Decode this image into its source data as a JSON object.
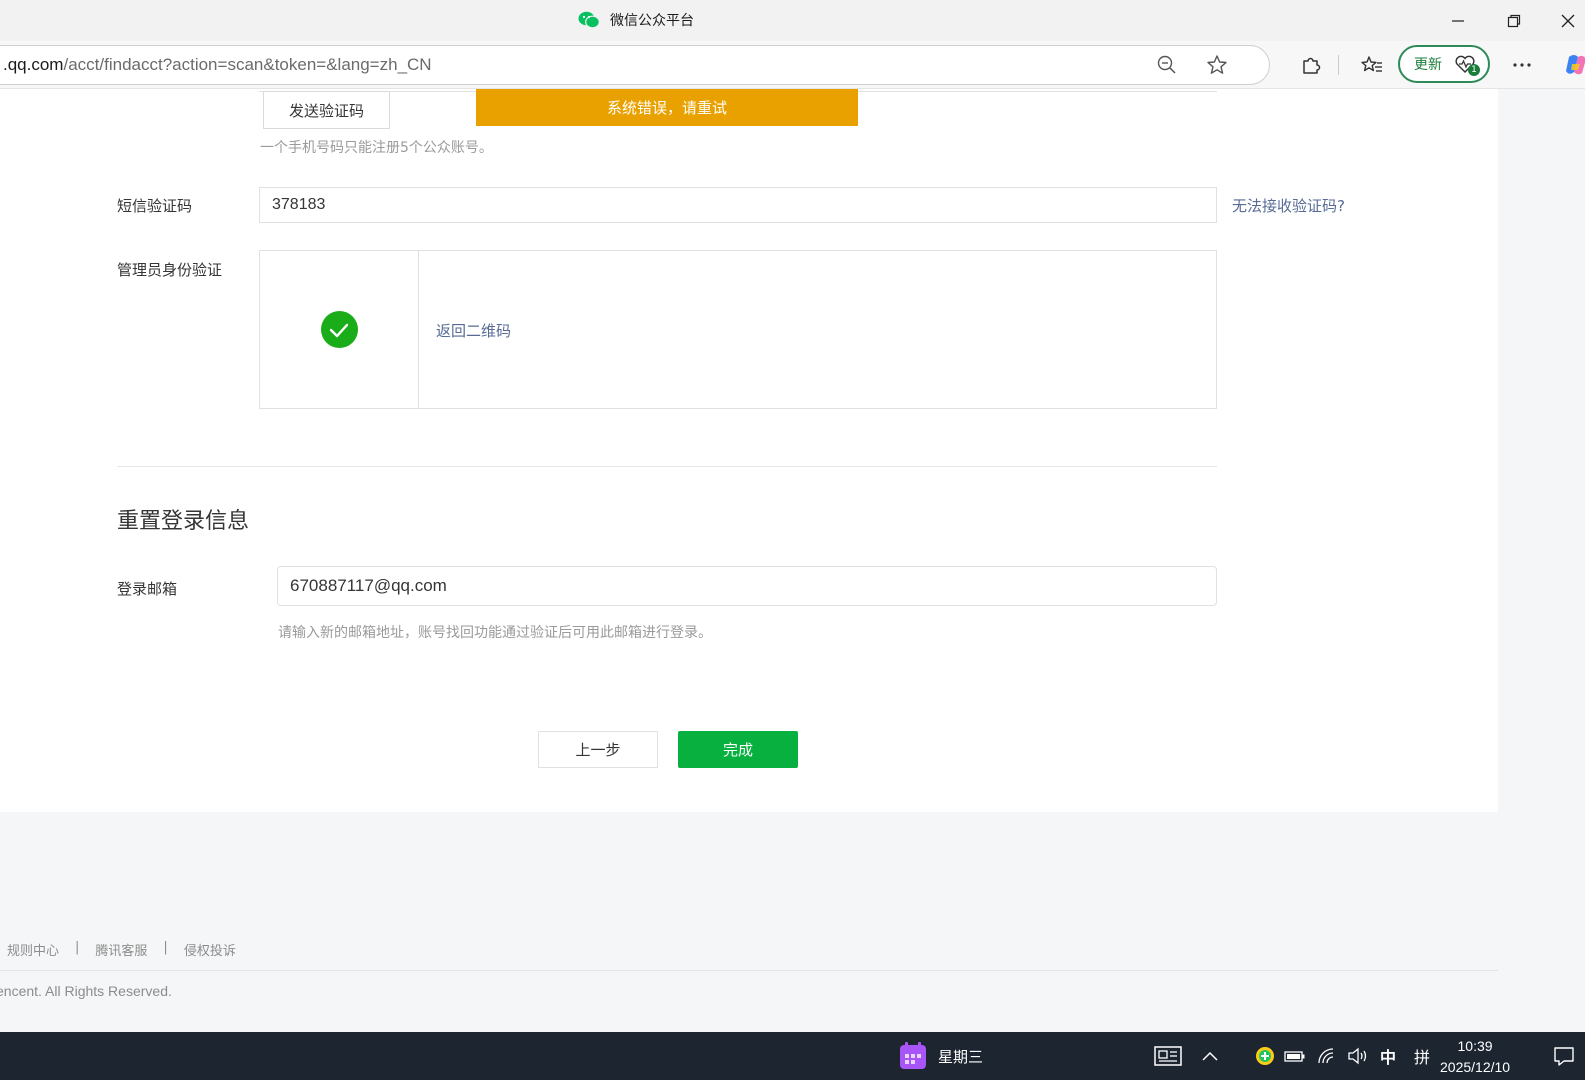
{
  "window": {
    "title": "微信公众平台"
  },
  "address_bar": {
    "url_host": ".qq.com",
    "url_path": "/acct/findacct?action=scan&token=&lang=zh_CN",
    "update_label": "更新",
    "update_badge": "1"
  },
  "form": {
    "send_code_label": "发送验证码",
    "toast_text": "系统错误，请重试",
    "phone_hint": "一个手机号码只能注册5个公众账号。",
    "sms_label": "短信验证码",
    "sms_value": "378183",
    "cant_receive_link": "无法接收验证码?",
    "admin_verify_label": "管理员身份验证",
    "back_to_qr_link": "返回二维码",
    "section_title": "重置登录信息",
    "email_label": "登录邮箱",
    "email_value": "670887117@qq.com",
    "email_hint": "请输入新的邮箱地址，账号找回功能通过验证后可用此邮箱进行登录。",
    "prev_button": "上一步",
    "done_button": "完成"
  },
  "footer": {
    "links": [
      "规则中心",
      "腾讯客服",
      "侵权投诉"
    ],
    "separator": "|",
    "copyright": "encent. All Rights Reserved."
  },
  "taskbar": {
    "weekday": "星期三",
    "ime_lang": "中",
    "ime_mode": "拼",
    "time": "10:39",
    "date": "2025/12/10"
  },
  "colors": {
    "toast_bg": "#e9a100",
    "primary_green": "#07b03f",
    "link_blue": "#576b95",
    "check_green": "#1aad19"
  }
}
